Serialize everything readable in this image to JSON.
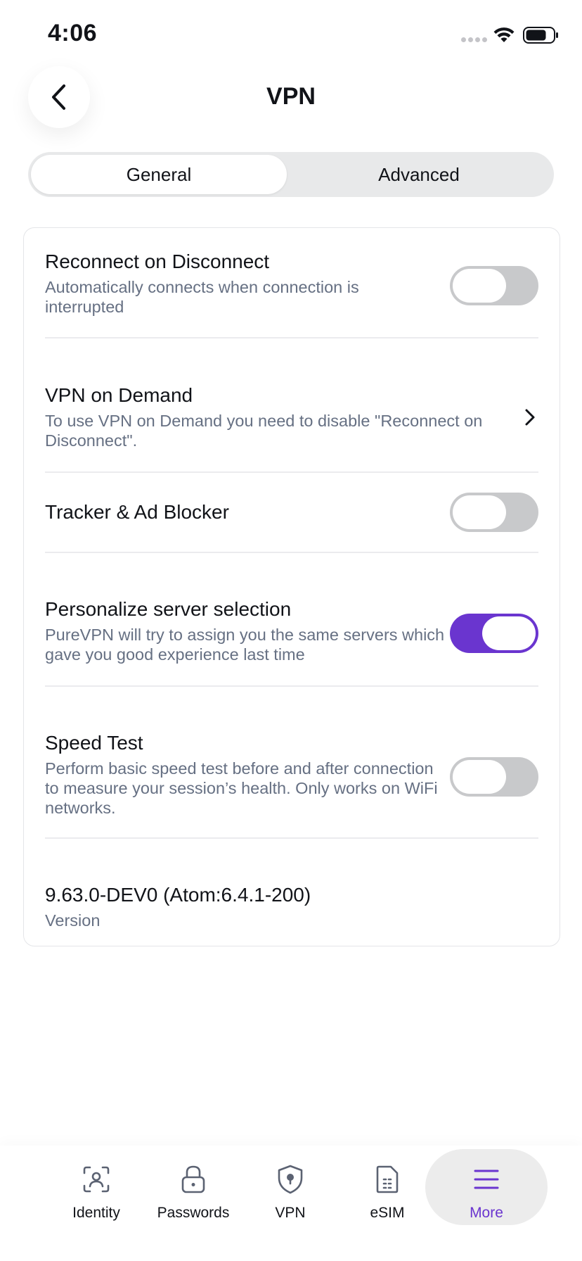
{
  "status_bar": {
    "time": "4:06"
  },
  "header": {
    "title": "VPN"
  },
  "tabs": {
    "general": "General",
    "advanced": "Advanced",
    "selected": "General"
  },
  "settings": {
    "reconnect": {
      "title": "Reconnect on Disconnect",
      "description": "Automatically connects when connection is interrupted",
      "enabled": false
    },
    "vpn_on_demand": {
      "title": "VPN on Demand",
      "description": "To use VPN on Demand you need to disable \"Reconnect on Disconnect\"."
    },
    "tracker_blocker": {
      "title": "Tracker & Ad Blocker",
      "enabled": false
    },
    "personalize": {
      "title": "Personalize server selection",
      "description": "PureVPN will try to assign you the same servers which gave you good experience last time",
      "enabled": true
    },
    "speed_test": {
      "title": "Speed Test",
      "description": "Perform basic speed test before and after connection to measure your session’s health. Only works on WiFi networks.",
      "enabled": false
    },
    "version": {
      "value": "9.63.0-DEV0 (Atom:6.4.1-200)",
      "label": "Version"
    }
  },
  "bottom_nav": {
    "items": [
      {
        "label": "Identity",
        "icon": "identity-icon"
      },
      {
        "label": "Passwords",
        "icon": "lock-icon"
      },
      {
        "label": "VPN",
        "icon": "shield-icon"
      },
      {
        "label": "eSIM",
        "icon": "esim-icon"
      },
      {
        "label": "More",
        "icon": "menu-icon"
      }
    ],
    "selected": "More"
  },
  "colors": {
    "accent": "#6a35cf",
    "toggle_off": "#c8c9cb",
    "text_secondary": "#667083"
  }
}
